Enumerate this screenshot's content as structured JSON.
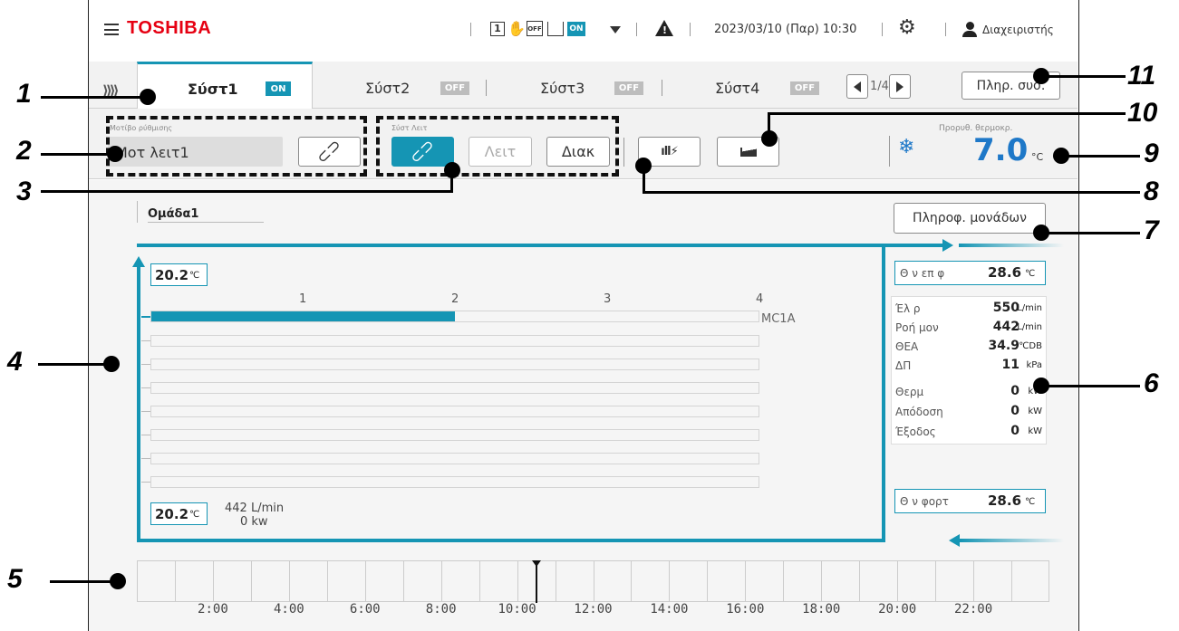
{
  "header": {
    "brand": "TOSHIBA",
    "status_on": "ON",
    "datetime": "2023/03/10 (Παρ) 10:30",
    "user": "Διαχειριστής"
  },
  "tabs": [
    {
      "label": "Σύστ1",
      "status": "ON"
    },
    {
      "label": "Σύστ2",
      "status": "OFF"
    },
    {
      "label": "Σύστ3",
      "status": "OFF"
    },
    {
      "label": "Σύστ4",
      "status": "OFF"
    }
  ],
  "pager": {
    "text": "1/4"
  },
  "system_info_button": "Πληρ. συσ.",
  "controls": {
    "pattern_label": "Μοτίβο ρύθμισης",
    "pattern_value": "Μοτ λειτ1",
    "link_label": "Σύστ Λειτ",
    "run_button": "Λειτ",
    "stop_button": "Διακ",
    "setpoint_label": "Προρυθ. θερμοκρ.",
    "setpoint_value": "7.0",
    "setpoint_unit": "°C"
  },
  "group": {
    "title": "Ομάδα1",
    "unit_info_button": "Πληροφ. μονάδων",
    "supply_temp": "20.2",
    "return_temp": "20.2",
    "temp_unit": "℃",
    "flow": "442 L/min",
    "power": "0 kw",
    "scale_labels": [
      "1",
      "2",
      "3",
      "4"
    ],
    "module_label": "MC1A",
    "module_fill_fraction": 0.5
  },
  "stats": {
    "inlet_label": "Θ ν επ φ",
    "inlet_value": "28.6",
    "inlet_unit": "℃",
    "rows": [
      {
        "label": "Έλ ρ",
        "value": "550",
        "unit": "L/min"
      },
      {
        "label": "Ροή μον",
        "value": "442",
        "unit": "L/min"
      },
      {
        "label": "ΘΕΑ",
        "value": "34.9",
        "unit": "℃DB"
      },
      {
        "label": "ΔΠ",
        "value": "11",
        "unit": "kPa"
      },
      {
        "label": "Θερμ",
        "value": "0",
        "unit": "kW"
      },
      {
        "label": "Απόδοση",
        "value": "0",
        "unit": "kW"
      },
      {
        "label": "Έξοδος",
        "value": "0",
        "unit": "kW"
      }
    ],
    "load_label": "Θ ν φορτ",
    "load_value": "28.6",
    "load_unit": "℃"
  },
  "timeline": {
    "labels": [
      "2:00",
      "4:00",
      "6:00",
      "8:00",
      "10:00",
      "12:00",
      "14:00",
      "16:00",
      "18:00",
      "20:00",
      "22:00"
    ],
    "current_time_fraction": 0.4375
  },
  "callouts": [
    "1",
    "2",
    "3",
    "4",
    "5",
    "6",
    "7",
    "8",
    "9",
    "10",
    "11"
  ],
  "colors": {
    "accent": "#1595b4",
    "brand": "#e60012"
  }
}
